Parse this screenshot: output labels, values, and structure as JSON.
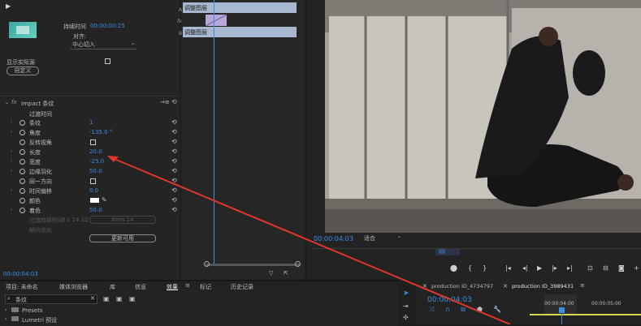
{
  "effect_controls": {
    "duration_label": "持续时间",
    "duration_value": "00:00:00:25",
    "align_label": "对齐:",
    "align_value": "中心切入",
    "show_real_source": "显示实际源",
    "custom_button": "自定义",
    "effect_name": "Impact 条纹",
    "transition_time": "过渡时间",
    "params": [
      {
        "label": "条纹",
        "value": "1"
      },
      {
        "label": "角度",
        "value": "-135.0 °"
      },
      {
        "label": "反转视角",
        "value": ""
      },
      {
        "label": "长度",
        "value": "20.0"
      },
      {
        "label": "宽度",
        "value": "-25.0"
      },
      {
        "label": "边缘羽化",
        "value": "50.0"
      },
      {
        "label": "同一方向",
        "value": ""
      },
      {
        "label": "时间偏移",
        "value": "0.0"
      },
      {
        "label": "颜色",
        "value": ""
      },
      {
        "label": "着色",
        "value": "50.0"
      }
    ],
    "disabled_row1": "过渡持续时间",
    "disabled_row1_value": "3 s 14 12",
    "disabled_row1_btn": "Item 14",
    "disabled_row2": "帧内优化",
    "update_button": "更新可用",
    "timecode": "00:00:04:03"
  },
  "mini_timeline": {
    "clip_top": "调整图层",
    "clip_bottom": "调整图层",
    "track_a": "A",
    "track_fx": "fx",
    "track_b": "B"
  },
  "program_monitor": {
    "timecode": "00:00:04:03",
    "fit_label": "适合"
  },
  "project_tabs": [
    "项目: 未命名",
    "媒体浏览器",
    "库",
    "信息",
    "效果",
    "标记",
    "历史记录"
  ],
  "effects": {
    "search_value": "条纹",
    "items": [
      "Presets",
      "Lumetri 预设"
    ]
  },
  "sequence": {
    "tab1": "production ID_4734797",
    "tab2": "production ID_3989431",
    "timecode": "00:00:04:03",
    "ruler1": "00:00:04:00",
    "ruler2": "00:00:05:00"
  },
  "colors": {
    "accent": "#3a8ee6",
    "annotation_arrow": "#e0362b",
    "clip": "#a8b8d0"
  }
}
